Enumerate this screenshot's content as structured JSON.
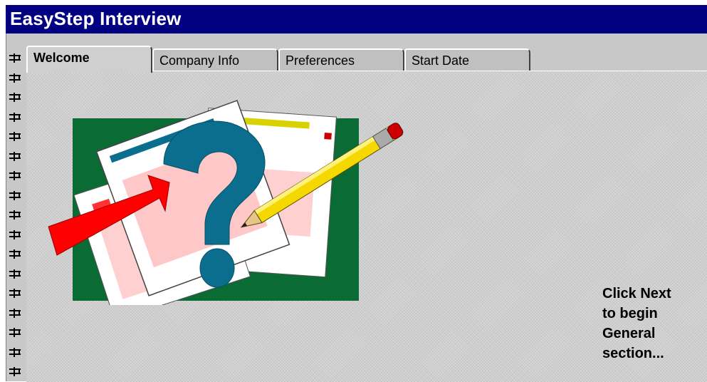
{
  "window": {
    "title": "EasyStep Interview"
  },
  "tabs": [
    {
      "label": "Welcome",
      "active": true
    },
    {
      "label": "Company Info",
      "active": false
    },
    {
      "label": "Preferences",
      "active": false
    },
    {
      "label": "Start Date",
      "active": false
    }
  ],
  "illustration": {
    "icon": "question-document-pencil-arrow",
    "colors": {
      "background_square": "#0b6b35",
      "question_mark": "#0b6e8f",
      "arrow": "#ff0000",
      "pencil": "#f5d800"
    }
  },
  "message": {
    "line1": "Click Next",
    "line2": "to begin",
    "line3": "General",
    "line4": "section..."
  },
  "colors": {
    "titlebar": "#000080",
    "panel": "#cfcfcf"
  }
}
